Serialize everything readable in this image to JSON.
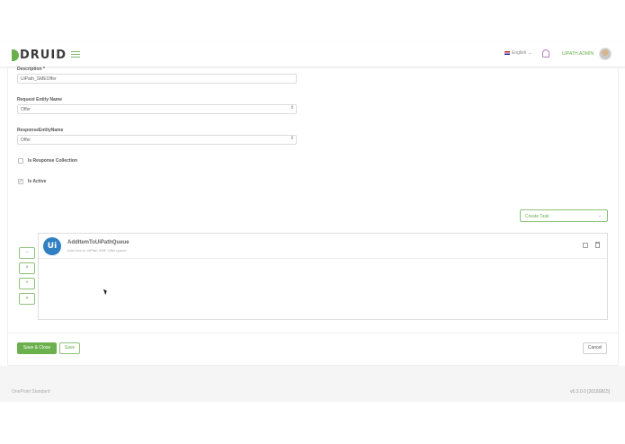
{
  "header": {
    "logo": "DRUID",
    "language": "English",
    "user": "UIPATH.ADMIN"
  },
  "form": {
    "description_label": "Description *",
    "description_value": "UiPath_SMEOffer",
    "request_entity_label": "Request Entity Name",
    "request_entity_value": "Offer",
    "response_entity_label": "ResponseEntityName",
    "response_entity_value": "Offer",
    "is_response_collection_label": "Is Response Collection",
    "is_response_collection_checked": false,
    "is_active_label": "Is Active",
    "is_active_checked": true
  },
  "tasks": {
    "create_task_label": "Create Task",
    "side_buttons": [
      "−",
      "×",
      "+",
      "»"
    ],
    "item": {
      "title": "AddItemToUiPathQueue",
      "subtitle": "Add Item to UiPath SME Offer queue"
    }
  },
  "actions": {
    "save_close": "Save & Close",
    "save": "Save",
    "cancel": "Cancel"
  },
  "footer": {
    "left": "OnePoint Standard",
    "right": "v6.3.0.0 [20180815]"
  },
  "colors": {
    "accent": "#6ab04c",
    "brand_blue": "#2f7fc2"
  }
}
